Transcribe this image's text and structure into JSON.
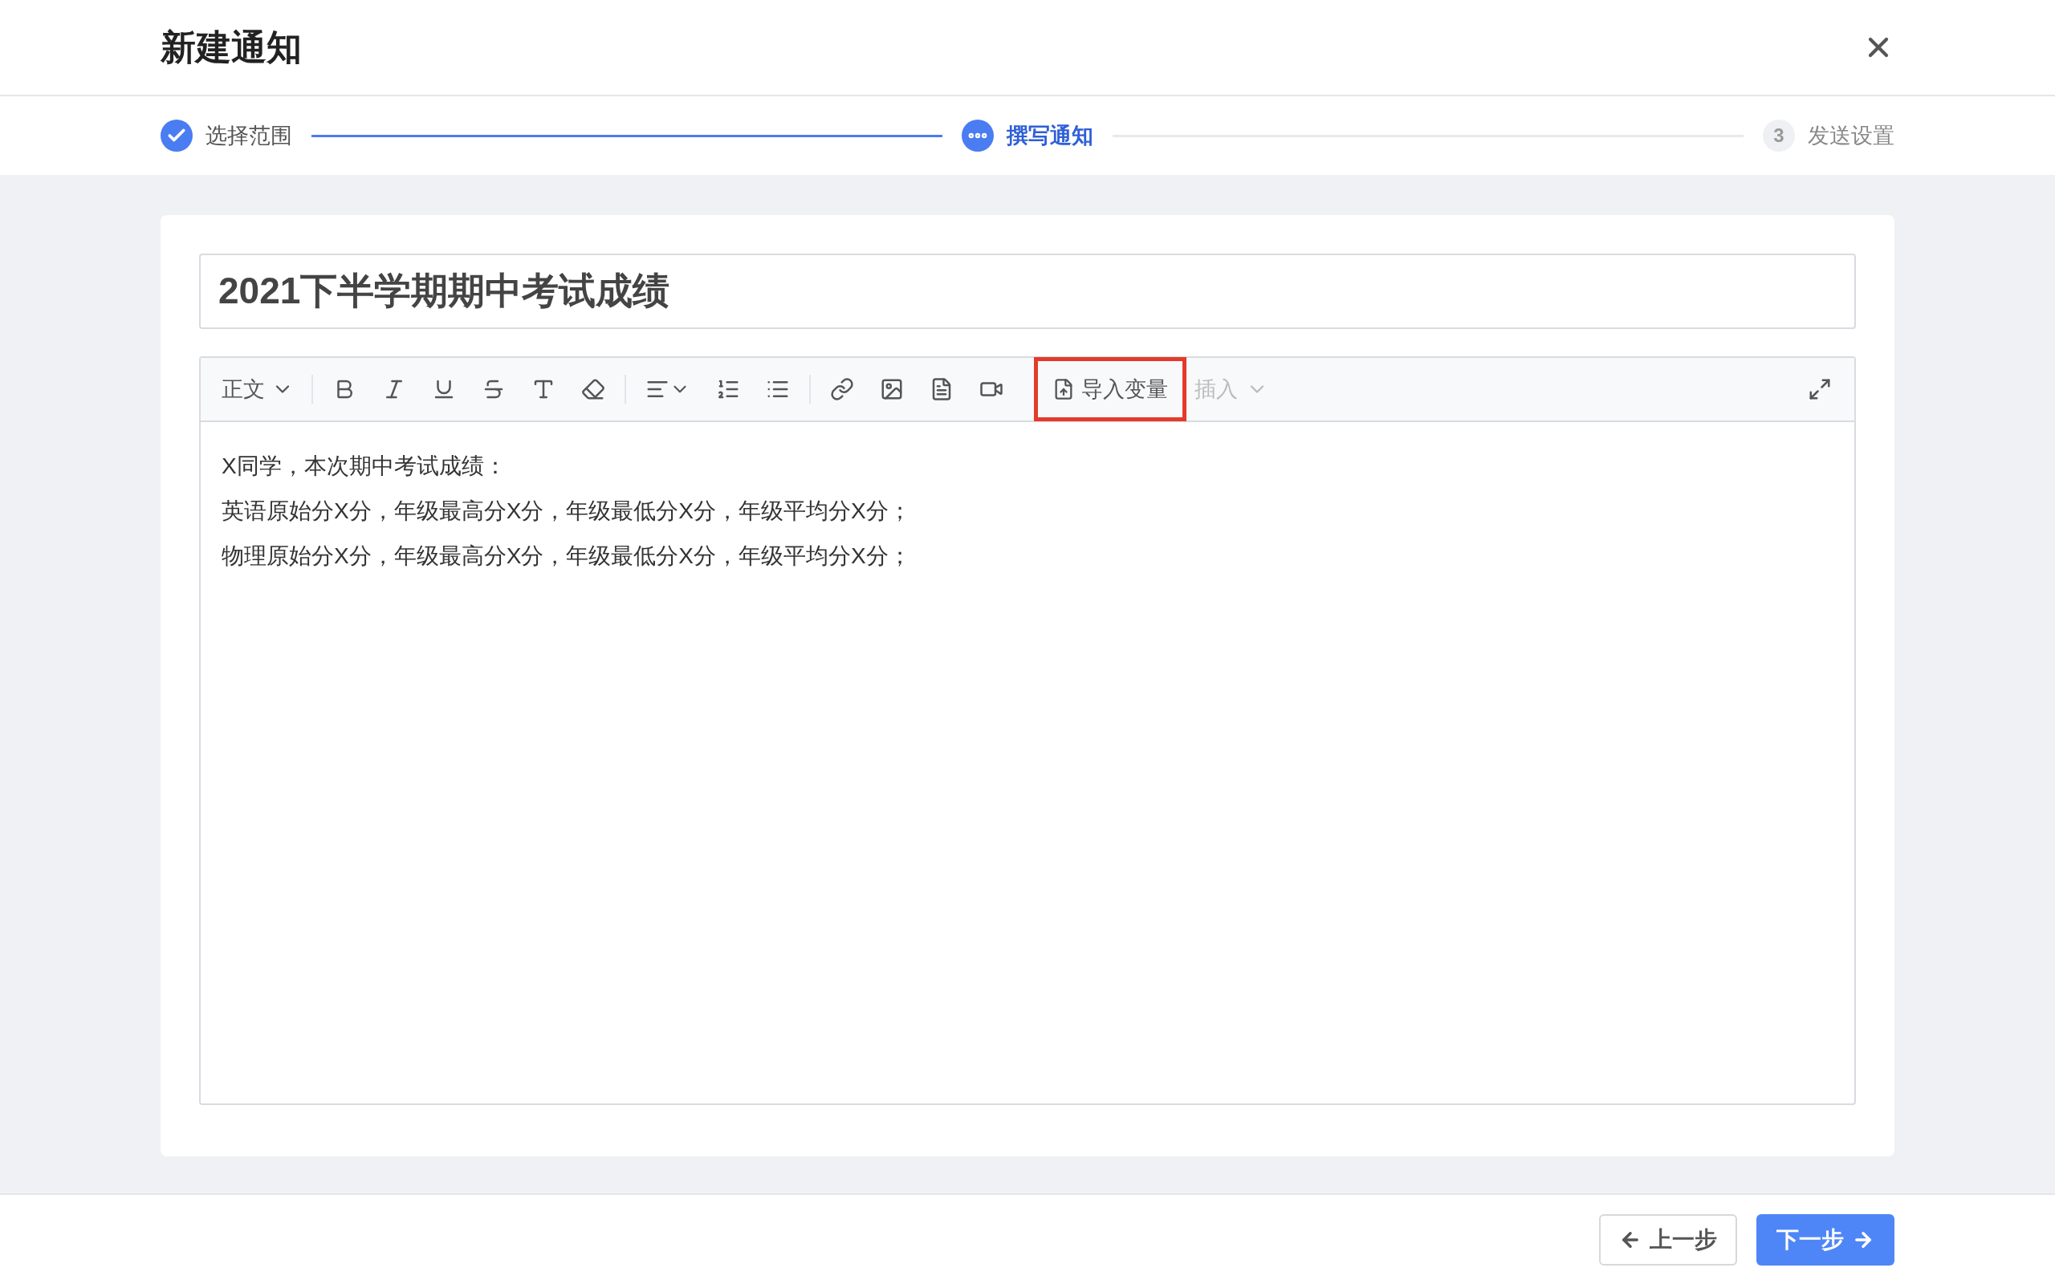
{
  "dialog": {
    "title": "新建通知"
  },
  "steps": [
    {
      "label": "选择范围",
      "completed": true,
      "selected": false
    },
    {
      "label": "撰写通知",
      "completed": false,
      "selected": true
    },
    {
      "label": "发送设置",
      "completed": false,
      "selected": false,
      "number": "3"
    }
  ],
  "subject": {
    "value": "2021下半学期期中考试成绩"
  },
  "toolbar": {
    "format": {
      "label": "正文"
    },
    "import_variable": {
      "label": "导入变量",
      "highlighted": true
    },
    "insert": {
      "label": "插入",
      "disabled": true
    }
  },
  "editor": {
    "lines": [
      "X同学，本次期中考试成绩：",
      "英语原始分X分，年级最高分X分，年级最低分X分，年级平均分X分；",
      "物理原始分X分，年级最高分X分，年级最低分X分，年级平均分X分；"
    ]
  },
  "footer": {
    "prev": "上一步",
    "next": "下一步"
  }
}
